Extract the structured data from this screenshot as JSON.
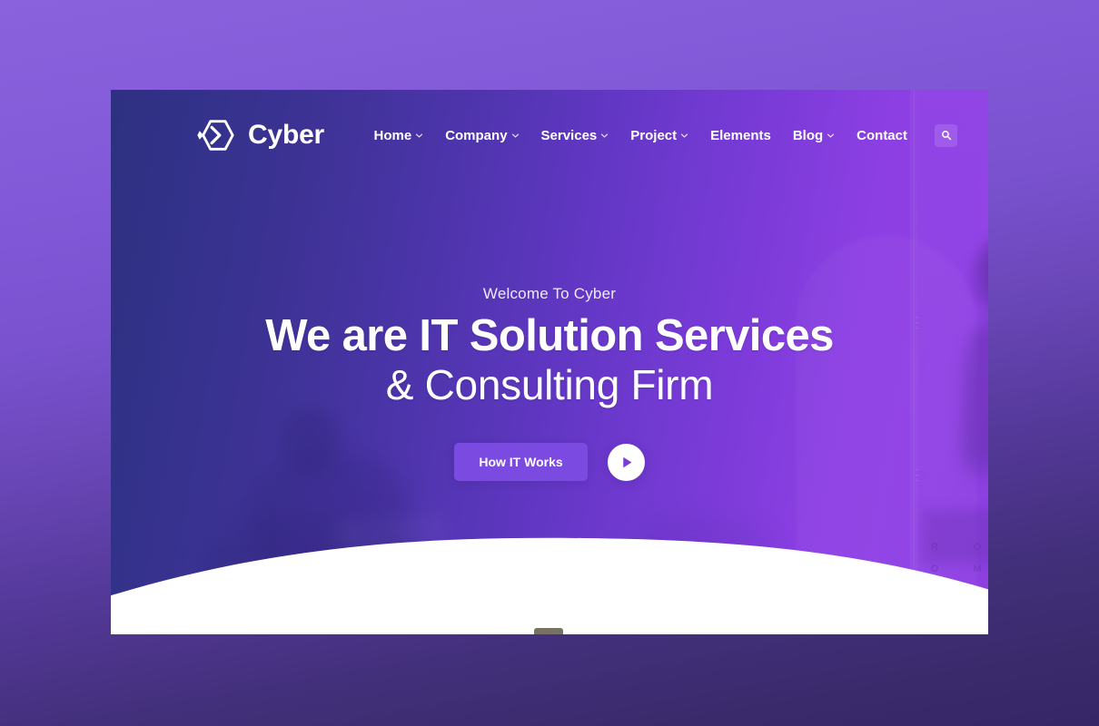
{
  "site": {
    "brand": {
      "name": "Cyber",
      "logo_icon": "cyber-hexagon-chevron-logo"
    },
    "nav": {
      "items": [
        {
          "label": "Home",
          "has_dropdown": true
        },
        {
          "label": "Company",
          "has_dropdown": true
        },
        {
          "label": "Services",
          "has_dropdown": true
        },
        {
          "label": "Project",
          "has_dropdown": true
        },
        {
          "label": "Elements",
          "has_dropdown": false
        },
        {
          "label": "Blog",
          "has_dropdown": true
        },
        {
          "label": "Contact",
          "has_dropdown": false
        }
      ],
      "search_icon": "search-icon"
    }
  },
  "hero": {
    "eyebrow": "Welcome To Cyber",
    "headline_line1": "We are IT Solution Services",
    "headline_line2": "& Consulting Firm",
    "primary_cta": "How IT Works",
    "play_icon": "play-icon"
  },
  "background": {
    "wall_letters": [
      "R",
      "O",
      "O",
      "M"
    ]
  },
  "colors": {
    "panel_gradient_start": "#2e3181",
    "panel_gradient_end": "#9040e6",
    "page_backdrop_top": "#8a62dd",
    "page_backdrop_bottom": "#362668",
    "cta_purple": "#7b4ae0",
    "text_white": "#ffffff",
    "curve_white": "#ffffff"
  }
}
